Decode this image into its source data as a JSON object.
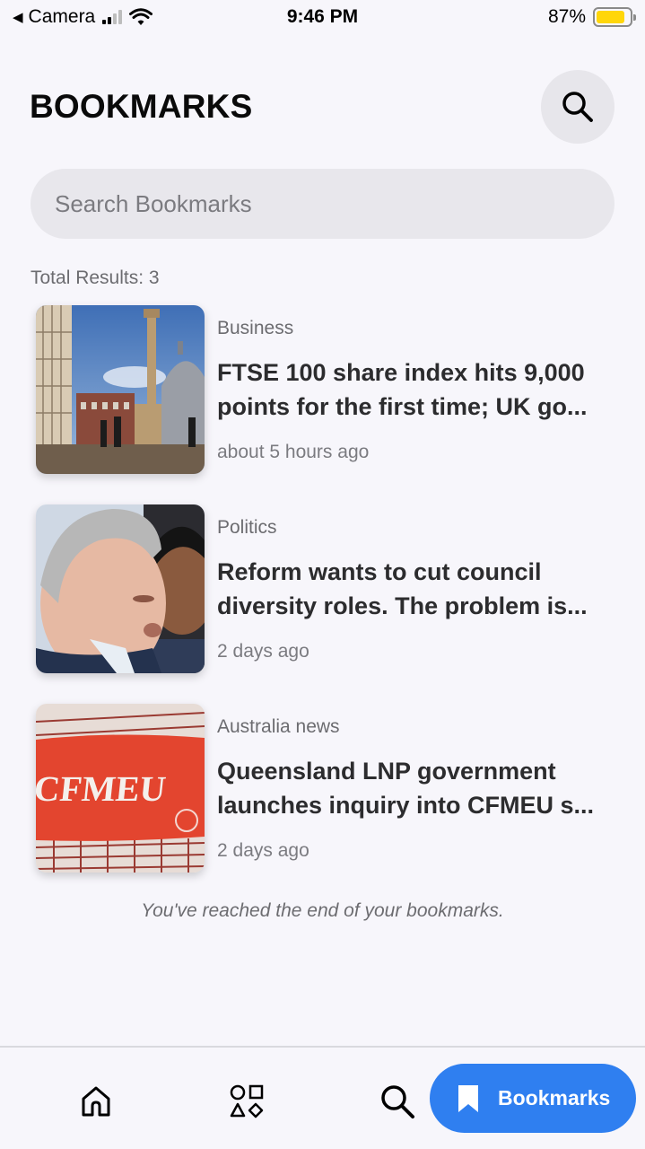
{
  "status_bar": {
    "back_app": "Camera",
    "time": "9:46 PM",
    "battery": "87%",
    "battery_level": 0.87,
    "battery_color": "#ffd60a"
  },
  "header": {
    "title": "BOOKMARKS",
    "search_button_icon": "search-icon"
  },
  "search": {
    "placeholder": "Search Bookmarks",
    "value": ""
  },
  "results": {
    "label": "Total Results: 3"
  },
  "bookmarks": [
    {
      "category": "Business",
      "headline": "FTSE 100 share index hits 9,000 points for the first time; UK go...",
      "time": "about 5 hours ago"
    },
    {
      "category": "Politics",
      "headline": "Reform wants to cut council diversity roles. The problem is...",
      "time": "2 days ago"
    },
    {
      "category": "Australia news",
      "headline": "Queensland LNP government launches inquiry into CFMEU s...",
      "time": "2 days ago",
      "image_text": "CFMEU"
    }
  ],
  "end_note": "You've reached the end of your bookmarks.",
  "bottom_nav": {
    "items": [
      {
        "icon": "home-icon"
      },
      {
        "icon": "categories-icon"
      },
      {
        "icon": "search-icon"
      },
      {
        "icon": "bookmark-icon",
        "label": "Bookmarks",
        "active": true
      }
    ],
    "accent": "#2f7ff0"
  }
}
